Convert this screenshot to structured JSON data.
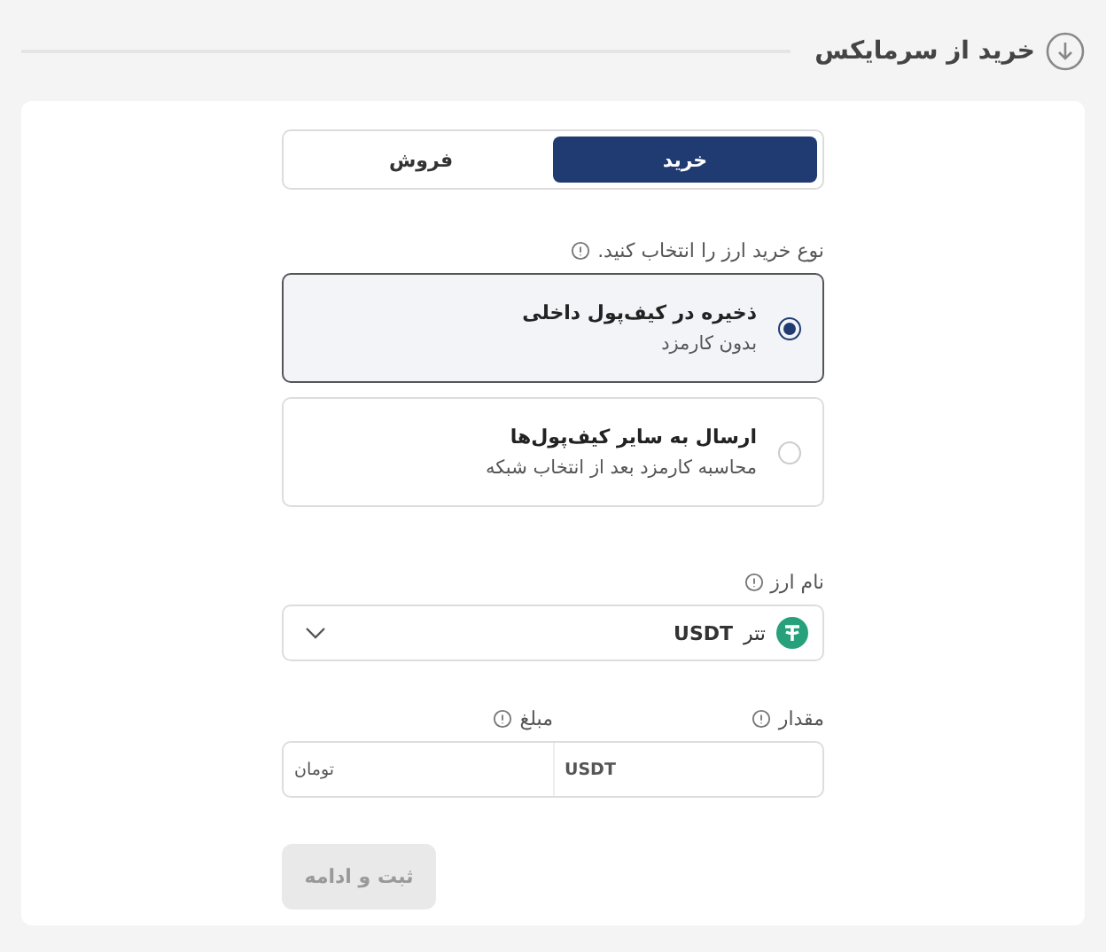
{
  "header": {
    "title": "خرید از سرمایکس"
  },
  "tabs": [
    {
      "label": "خرید",
      "selected": true
    },
    {
      "label": "فروش",
      "selected": false
    }
  ],
  "purchase_type": {
    "label": "نوع خرید ارز را انتخاب کنید.",
    "options": [
      {
        "title": "ذخیره در کیف‌پول داخلی",
        "subtitle": "بدون کارمزد",
        "selected": true
      },
      {
        "title": "ارسال به سایر کیف‌پول‌ها",
        "subtitle": "محاسبه کارمزد بعد از انتخاب شبکه",
        "selected": false
      }
    ]
  },
  "currency": {
    "label": "نام ارز",
    "name": "تتر",
    "symbol": "USDT"
  },
  "amount_fields": [
    {
      "label": "مقدار",
      "unit": "USDT"
    },
    {
      "label": "مبلغ",
      "unit": "تومان"
    }
  ],
  "submit": {
    "label": "ثبت و ادامه",
    "disabled": true
  }
}
